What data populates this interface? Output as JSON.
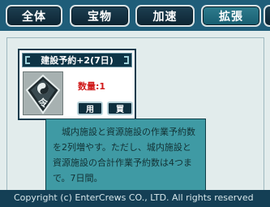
{
  "tabs": [
    {
      "label": "全体",
      "active": false
    },
    {
      "label": "宝物",
      "active": false
    },
    {
      "label": "加速",
      "active": false
    },
    {
      "label": "拡張",
      "active": true
    }
  ],
  "item": {
    "title": "建設予約+2(7日)",
    "quantity_text": "数量:1",
    "icon": "reservation-token-icon",
    "use_label": "用",
    "buy_label": "買"
  },
  "tooltip": {
    "text": "城内施設と資源施設の作業予約数を2列増やす。ただし、城内施設と資源施設の合計作業予約数は4つまで。7日間。"
  },
  "footer": {
    "copyright": "Copyright (c) EnterCrews CO., LTD. All rights reserved"
  },
  "colors": {
    "tab_border": "#d9e3e6",
    "tab_bg": "#0d2533",
    "panel_bg": "#e2ecec",
    "tooltip_bg": "#3f9aa4",
    "quantity_red": "#d01818"
  }
}
